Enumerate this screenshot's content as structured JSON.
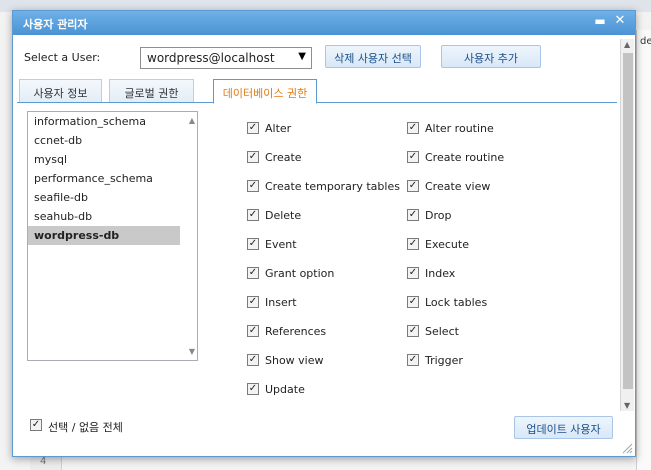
{
  "window": {
    "title": "사용자 관리자"
  },
  "user_selector": {
    "label": "Select a User:",
    "selected": "wordpress@localhost"
  },
  "buttons": {
    "delete_user": "삭제 사용자 선택",
    "add_user": "사용자 추가",
    "update_user": "업데이트 사용자"
  },
  "tabs": [
    {
      "label": "사용자 정보"
    },
    {
      "label": "글로벌 권한"
    },
    {
      "label": "데이터베이스 권한"
    }
  ],
  "databases": [
    "information_schema",
    "ccnet-db",
    "mysql",
    "performance_schema",
    "seafile-db",
    "seahub-db",
    "wordpress-db"
  ],
  "selected_database": "wordpress-db",
  "permissions_left": [
    {
      "label": "Alter",
      "checked": true
    },
    {
      "label": "Create",
      "checked": true
    },
    {
      "label": "Create temporary tables",
      "checked": true
    },
    {
      "label": "Delete",
      "checked": true
    },
    {
      "label": "Event",
      "checked": true
    },
    {
      "label": "Grant option",
      "checked": true
    },
    {
      "label": "Insert",
      "checked": true
    },
    {
      "label": "References",
      "checked": true
    },
    {
      "label": "Show view",
      "checked": true
    },
    {
      "label": "Update",
      "checked": true
    }
  ],
  "permissions_right": [
    {
      "label": "Alter routine",
      "checked": true
    },
    {
      "label": "Create routine",
      "checked": true
    },
    {
      "label": "Create view",
      "checked": true
    },
    {
      "label": "Drop",
      "checked": true
    },
    {
      "label": "Execute",
      "checked": true
    },
    {
      "label": "Index",
      "checked": true
    },
    {
      "label": "Lock tables",
      "checked": true
    },
    {
      "label": "Select",
      "checked": true
    },
    {
      "label": "Trigger",
      "checked": true
    }
  ],
  "select_all": {
    "label": "선택 / 없음 전체",
    "checked": true
  },
  "background": {
    "line_number": "4",
    "right_text": "de"
  },
  "colors": {
    "title_bar": "#4a93d4",
    "active_tab_text": "#e07b16",
    "border": "#5c9bd1"
  }
}
